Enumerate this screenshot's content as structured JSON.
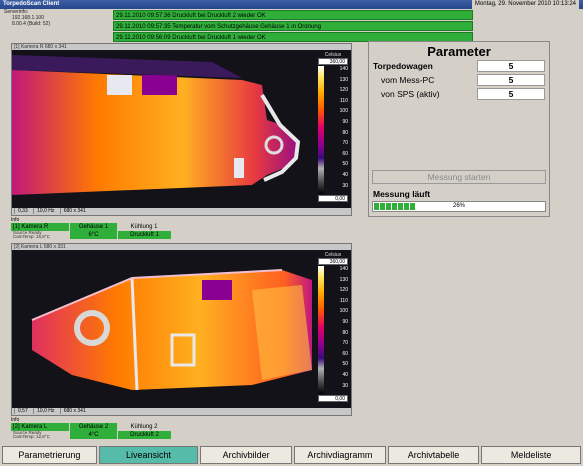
{
  "window": {
    "title": "TorpedoScan Client",
    "date": "Montag, 29. November 2010 10:13:24"
  },
  "server": {
    "label": "Serverinfo:",
    "ip": "192.168.1.100",
    "version": "8.00.4 (Build: 52)"
  },
  "messages": [
    "29.11.2010 09:57:36 Druckluft bei Druckluft 2 wieder OK",
    "29.11.2010 09:57:35 Temperatur vom Schutzgehäuse Gehäuse 1 in Ordnung",
    "29.11.2010 09:56:09 Druckluft bei Druckluft 1 wieder OK"
  ],
  "camera_r": {
    "caption": "[1] Kamera R 680 x 341",
    "scale_label": "Celsius",
    "scale_max": "360,00",
    "scale_min": "0,00",
    "ticks": [
      "140",
      "130",
      "120",
      "110",
      "100",
      "90",
      "80",
      "70",
      "60",
      "50",
      "40",
      "30"
    ],
    "footer": [
      "0,33",
      "10,0 Hz",
      "680 x 341"
    ],
    "info": "Info",
    "name": "[1] Kamera R",
    "housing_label": "Gehäuse 1",
    "cooling_label": "Kühlung 1",
    "source": "Source Ready",
    "camtemp": "CamTemp: 15,8°C",
    "temp": "6°C",
    "air": "Druckluft 1"
  },
  "camera_l": {
    "caption": "[2] Kamera L 680 x 331",
    "scale_label": "Celsius",
    "scale_max": "360,00",
    "scale_min": "0,00",
    "ticks": [
      "140",
      "130",
      "120",
      "110",
      "100",
      "90",
      "80",
      "70",
      "60",
      "50",
      "40",
      "30"
    ],
    "footer": [
      "0,57",
      "10,0 Hz",
      "680 x 341"
    ],
    "info": "Info",
    "name": "[2] Kamera L",
    "housing_label": "Gehäuse 2",
    "cooling_label": "Kühlung 2",
    "source": "Source Ready",
    "camtemp": "CamTemp: 12,8°C",
    "temp": "4°C",
    "air": "Druckluft 2"
  },
  "parameter": {
    "title": "Parameter",
    "torpedo_label": "Torpedowagen",
    "torpedo_value": "5",
    "pc_label": "vom Mess-PC",
    "pc_value": "5",
    "sps_label": "von SPS (aktiv)",
    "sps_value": "5",
    "start_button": "Messung starten",
    "status": "Messung läuft",
    "progress_percent": "26%",
    "progress_value": 0.26
  },
  "tabs": [
    "Parametrierung",
    "Liveansicht",
    "Archivbilder",
    "Archivdiagramm",
    "Archivtabelle",
    "Meldeliste"
  ],
  "colors": {
    "ok_green": "#2fae3a",
    "active_tab": "#57bba9"
  }
}
